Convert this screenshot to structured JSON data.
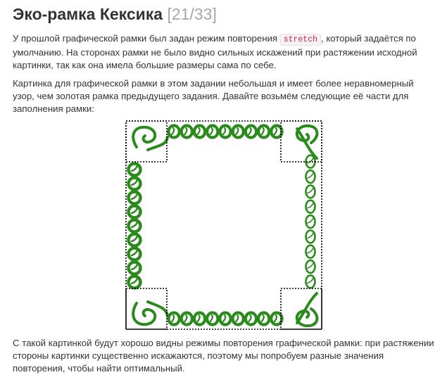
{
  "title": {
    "text": "Эко-рамка Кексика",
    "counter": "[21/33]"
  },
  "paragraph1": {
    "before": "У прошлой графической рамки был задан режим повторения ",
    "code": "stretch",
    "after": ", который задаётся по умолчанию. На сторонах рамки не было видно сильных искажений при растяжении исходной картинки, так как она имела большие размеры сама по себе."
  },
  "paragraph2": {
    "text": "Картинка для графической рамки в этом задании небольшая и имеет более неравномерный узор, чем золотая рамка предыдущего задания. Давайте возьмём следующие её части для заполнения рамки:"
  },
  "paragraph3": {
    "text": "С такой картинкой будут хорошо видны режимы повторения графической рамки: при растяжении стороны картинки существенно искажаются, поэтому мы попробуем разные значения повторения, чтобы найти оптимальный."
  },
  "figure": {
    "ornament_color": "#2a8a1c",
    "guide_color": "#000000"
  }
}
